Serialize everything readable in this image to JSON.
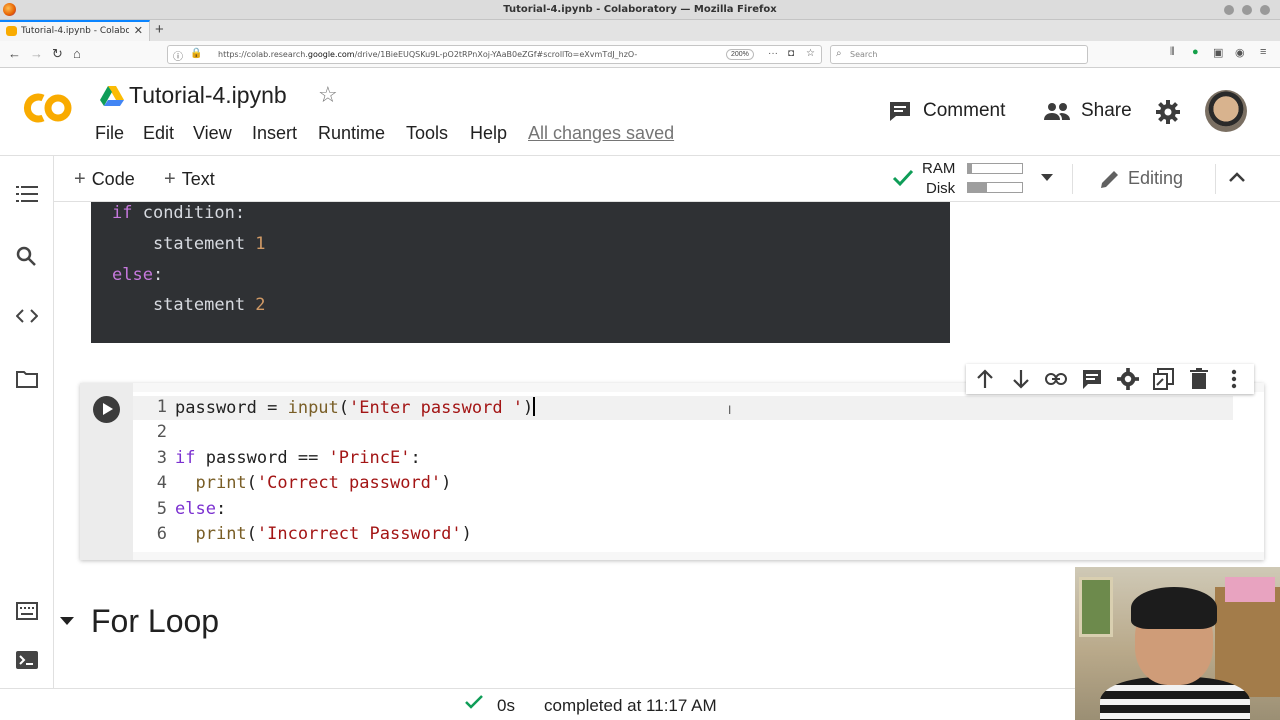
{
  "browser": {
    "window_title": "Tutorial-4.ipynb - Colaboratory — Mozilla Firefox",
    "tab_title": "Tutorial-4.ipynb - Colaborato",
    "url_prefix": "https://colab.research.",
    "url_domain": "google.com",
    "url_suffix": "/drive/1BieEUQSKu9L-pO2tRPnXoj-YAaB0eZGf#scrollTo=eXvmTdJ_hzO-",
    "zoom": "200%",
    "search_placeholder": "Search"
  },
  "header": {
    "notebook_title": "Tutorial-4.ipynb",
    "menu": [
      "File",
      "Edit",
      "View",
      "Insert",
      "Runtime",
      "Tools",
      "Help"
    ],
    "save_status": "All changes saved",
    "comment_label": "Comment",
    "share_label": "Share"
  },
  "toolbar": {
    "add_code": "Code",
    "add_text": "Text",
    "ram_label": "RAM",
    "disk_label": "Disk",
    "ram_usage": 0.08,
    "disk_usage": 0.35,
    "editing_label": "Editing"
  },
  "syntax_example": {
    "lines": [
      {
        "kw": "if",
        "rest": " condition:"
      },
      {
        "text": "    statement ",
        "num": "1"
      },
      {
        "kw": "else",
        "rest": ":"
      },
      {
        "text": "    statement ",
        "num": "2"
      }
    ]
  },
  "code_cell": {
    "line_numbers": [
      "1",
      "2",
      "3",
      "4",
      "5",
      "6"
    ],
    "line1": {
      "a": "password = ",
      "fn": "input",
      "b": "(",
      "str": "'Enter password '",
      "c": ")"
    },
    "line3": {
      "kw": "if",
      "a": " password == ",
      "str": "'PrincE'",
      "b": ":"
    },
    "line4": {
      "a": "  ",
      "fn": "print",
      "b": "(",
      "str": "'Correct password'",
      "c": ")"
    },
    "line5": {
      "kw": "else",
      "a": ":"
    },
    "line6": {
      "a": "  ",
      "fn": "print",
      "b": "(",
      "str": "'Incorrect Password'",
      "c": ")"
    }
  },
  "section": {
    "title": "For Loop"
  },
  "status": {
    "duration": "0s",
    "message": "completed at 11:17 AM"
  },
  "colors": {
    "colab_orange": "#f9ab00",
    "check_green": "#0f9d58"
  }
}
